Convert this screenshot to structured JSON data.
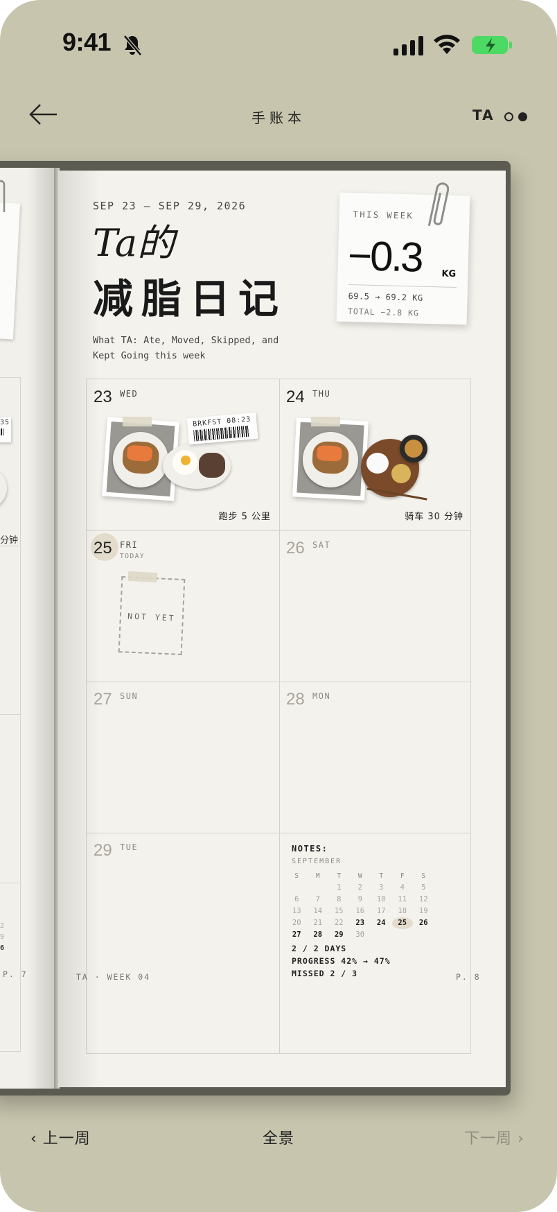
{
  "status_bar": {
    "time": "9:41"
  },
  "nav": {
    "title": "手账本",
    "user_label": "TA"
  },
  "left_page": {
    "footer": "P. 7",
    "peek_texts": [
      "35",
      "分钟"
    ],
    "cal_peek": [
      "2",
      "9",
      "6"
    ]
  },
  "page": {
    "date_range": "SEP 23 — SEP 29, 2026",
    "title_line1": "Ta的",
    "title_line2": "减脂日记",
    "subtitle": "What TA: Ate, Moved, Skipped, and Kept Going this week",
    "footer_left": "TA · WEEK 04",
    "footer_right": "P. 8"
  },
  "weight_card": {
    "label": "THIS WEEK",
    "value": "−0.3",
    "unit": "KG",
    "range": "69.5 → 69.2 KG",
    "total": "TOTAL −2.8 KG"
  },
  "days": [
    {
      "num": "23",
      "name": "WED",
      "activity": "跑步 5 公里",
      "receipt": "BRKFST 08:23"
    },
    {
      "num": "24",
      "name": "THU",
      "activity": "骑车 30 分钟"
    },
    {
      "num": "25",
      "name": "FRI",
      "sub": "TODAY",
      "placeholder": "NOT YET"
    },
    {
      "num": "26",
      "name": "SAT"
    },
    {
      "num": "27",
      "name": "SUN"
    },
    {
      "num": "28",
      "name": "MON"
    },
    {
      "num": "29",
      "name": "TUE"
    }
  ],
  "notes": {
    "title": "NOTES:",
    "month": "SEPTEMBER",
    "weekdays": [
      "S",
      "M",
      "T",
      "W",
      "T",
      "F",
      "S"
    ],
    "weeks": [
      [
        "",
        "",
        "1",
        "2",
        "3",
        "4",
        "5"
      ],
      [
        "6",
        "7",
        "8",
        "9",
        "10",
        "11",
        "12"
      ],
      [
        "13",
        "14",
        "15",
        "16",
        "17",
        "18",
        "19"
      ],
      [
        "20",
        "21",
        "22",
        "23",
        "24",
        "25",
        "26"
      ],
      [
        "27",
        "28",
        "29",
        "30",
        "",
        "",
        ""
      ]
    ],
    "highlighted": [
      "23",
      "24",
      "25",
      "26",
      "27",
      "28",
      "29"
    ],
    "today": "25",
    "stats": [
      "2 / 2 DAYS",
      "PROGRESS 42% → 47%",
      "MISSED 2 / 3"
    ]
  },
  "bottom_nav": {
    "prev": "‹ 上一周",
    "center": "全景",
    "next": "下一周 ›"
  },
  "colors": {
    "background": "#c7c5ad",
    "page": "#f4f2ec",
    "book_cover": "#5b5b51",
    "battery": "#4cd964"
  }
}
